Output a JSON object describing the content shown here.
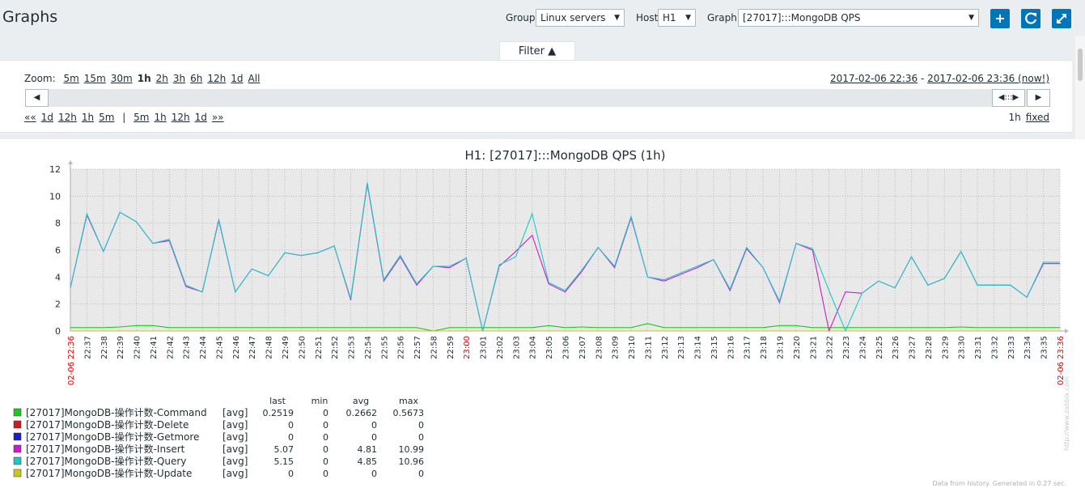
{
  "header": {
    "title": "Graphs",
    "group_label": "Group",
    "group_value": "Linux servers",
    "host_label": "Host",
    "host_value": "H1",
    "graph_label": "Graph",
    "graph_value": "[27017]:::MongoDB QPS"
  },
  "filter": {
    "tab_label": "Filter ▲",
    "zoom_label": "Zoom:",
    "zoom_options": [
      "5m",
      "15m",
      "30m",
      "1h",
      "2h",
      "3h",
      "6h",
      "12h",
      "1d",
      "All"
    ],
    "zoom_active": "1h",
    "period_from": "2017-02-06 22:36",
    "period_sep": " - ",
    "period_to": "2017-02-06 23:36 (now!)",
    "nav_back": [
      "««",
      "1d",
      "12h",
      "1h",
      "5m"
    ],
    "nav_sep": "|",
    "nav_fwd": [
      "5m",
      "1h",
      "12h",
      "1d",
      "»»"
    ],
    "period_len": "1h",
    "fixed_label": "fixed"
  },
  "colors": {
    "accent": "#0275b8",
    "command": "#1ec81e",
    "delete": "#c81e1e",
    "getmore": "#1e1ec8",
    "insert": "#c81ec8",
    "query": "#1ec8c8",
    "update": "#c8c81e",
    "red_label": "#dd0000"
  },
  "chart_data": {
    "type": "line",
    "title": "H1: [27017]:::MongoDB QPS (1h)",
    "ylim": [
      0,
      12
    ],
    "y_ticks": [
      "0",
      "2",
      "4",
      "6",
      "8",
      "10",
      "12"
    ],
    "x_start_label": "02-06 22:36",
    "x_end_label": "02-06 23:36",
    "x_mid_label": "23:00",
    "x_ticks": [
      "22:37",
      "22:38",
      "22:39",
      "22:40",
      "22:41",
      "22:42",
      "22:43",
      "22:44",
      "22:45",
      "22:46",
      "22:47",
      "22:48",
      "22:49",
      "22:50",
      "22:51",
      "22:52",
      "22:53",
      "22:54",
      "22:55",
      "22:56",
      "22:57",
      "22:58",
      "22:59",
      "23:00",
      "23:01",
      "23:02",
      "23:03",
      "23:04",
      "23:05",
      "23:06",
      "23:07",
      "23:08",
      "23:09",
      "23:10",
      "23:11",
      "23:12",
      "23:13",
      "23:14",
      "23:15",
      "23:16",
      "23:17",
      "23:18",
      "23:19",
      "23:20",
      "23:21",
      "23:22",
      "23:23",
      "23:24",
      "23:25",
      "23:26",
      "23:27",
      "23:28",
      "23:29",
      "23:30",
      "23:31",
      "23:32",
      "23:33",
      "23:34",
      "23:35"
    ],
    "grid": true,
    "series": [
      {
        "name": "[27017]MongoDB-操作计数-Command",
        "color": "#1ec81e",
        "values": [
          0.25,
          0.25,
          0.25,
          0.3,
          0.4,
          0.4,
          0.25,
          0.25,
          0.25,
          0.25,
          0.25,
          0.25,
          0.25,
          0.25,
          0.25,
          0.25,
          0.25,
          0.25,
          0.25,
          0.25,
          0.25,
          0.25,
          0.0,
          0.25,
          0.25,
          0.25,
          0.25,
          0.25,
          0.25,
          0.4,
          0.25,
          0.3,
          0.25,
          0.25,
          0.25,
          0.55,
          0.25,
          0.25,
          0.25,
          0.25,
          0.25,
          0.25,
          0.25,
          0.4,
          0.4,
          0.25,
          0.25,
          0.25,
          0.25,
          0.25,
          0.25,
          0.25,
          0.25,
          0.25,
          0.3,
          0.25,
          0.25,
          0.25,
          0.25,
          0.25,
          0.25
        ]
      },
      {
        "name": "[27017]MongoDB-操作计数-Insert",
        "color": "#c81ec8",
        "values": [
          3.2,
          8.6,
          5.9,
          8.8,
          8.1,
          6.5,
          6.7,
          3.3,
          2.9,
          8.2,
          2.9,
          4.6,
          4.1,
          5.8,
          5.6,
          5.8,
          6.3,
          2.3,
          10.9,
          3.7,
          5.5,
          3.4,
          4.8,
          4.7,
          5.4,
          0.0,
          4.8,
          5.9,
          7.1,
          3.5,
          2.9,
          4.4,
          6.2,
          4.7,
          8.4,
          4.0,
          3.7,
          4.2,
          4.7,
          5.3,
          3.0,
          6.1,
          4.7,
          2.1,
          6.5,
          6.0,
          0.0,
          2.9,
          2.8,
          3.7,
          3.2,
          5.5,
          3.4,
          3.9,
          5.9,
          3.4,
          3.4,
          3.4,
          2.5,
          5.0,
          5.0
        ]
      },
      {
        "name": "[27017]MongoDB-操作计数-Query",
        "color": "#1ec8c8",
        "values": [
          3.2,
          8.7,
          5.9,
          8.8,
          8.1,
          6.5,
          6.8,
          3.4,
          2.9,
          8.3,
          2.9,
          4.6,
          4.1,
          5.8,
          5.6,
          5.8,
          6.3,
          2.4,
          11.0,
          3.8,
          5.6,
          3.5,
          4.8,
          4.8,
          5.4,
          0.0,
          4.9,
          5.5,
          8.7,
          3.6,
          3.0,
          4.5,
          6.2,
          4.8,
          8.5,
          4.0,
          3.8,
          4.3,
          4.8,
          5.3,
          3.1,
          6.2,
          4.7,
          2.2,
          6.5,
          6.1,
          3.0,
          0.0,
          2.8,
          3.7,
          3.2,
          5.5,
          3.4,
          3.9,
          5.9,
          3.4,
          3.4,
          3.4,
          2.5,
          5.1,
          5.1
        ]
      },
      {
        "name": "[27017]MongoDB-操作计数-Getmore",
        "color": "#1e1ec8",
        "values": [
          0,
          0,
          0,
          0,
          0,
          0,
          0,
          0,
          0,
          0,
          0,
          0,
          0,
          0,
          0,
          0,
          0,
          0,
          0,
          0,
          0,
          0,
          0,
          0,
          0,
          0,
          0,
          0,
          0,
          0,
          0,
          0,
          0,
          0,
          0,
          0,
          0,
          0,
          0,
          0,
          0,
          0,
          0,
          0,
          0,
          0,
          0,
          0,
          0,
          0,
          0,
          0,
          0,
          0,
          0,
          0,
          0,
          0,
          0,
          0,
          0
        ]
      },
      {
        "name": "[27017]MongoDB-操作计数-Update",
        "color": "#c8c81e",
        "values": [
          0,
          0,
          0,
          0,
          0,
          0,
          0,
          0,
          0,
          0,
          0,
          0,
          0,
          0,
          0,
          0,
          0,
          0,
          0,
          0,
          0,
          0,
          0,
          0,
          0,
          0,
          0,
          0,
          0,
          0,
          0,
          0,
          0,
          0,
          0,
          0,
          0,
          0,
          0,
          0,
          0,
          0,
          0,
          0,
          0,
          0,
          0,
          0,
          0,
          0,
          0,
          0,
          0,
          0,
          0,
          0,
          0,
          0,
          0,
          0,
          0
        ]
      }
    ],
    "legend_headers": [
      "last",
      "min",
      "avg",
      "max"
    ],
    "legend": [
      {
        "name": "[27017]MongoDB-操作计数-Command",
        "color": "#1ec81e",
        "func": "[avg]",
        "last": "0.2519",
        "min": "0",
        "avg": "0.2662",
        "max": "0.5673"
      },
      {
        "name": "[27017]MongoDB-操作计数-Delete",
        "color": "#c81e1e",
        "func": "[avg]",
        "last": "0",
        "min": "0",
        "avg": "0",
        "max": "0"
      },
      {
        "name": "[27017]MongoDB-操作计数-Getmore",
        "color": "#1e1ec8",
        "func": "[avg]",
        "last": "0",
        "min": "0",
        "avg": "0",
        "max": "0"
      },
      {
        "name": "[27017]MongoDB-操作计数-Insert",
        "color": "#c81ec8",
        "func": "[avg]",
        "last": "5.07",
        "min": "0",
        "avg": "4.81",
        "max": "10.99"
      },
      {
        "name": "[27017]MongoDB-操作计数-Query",
        "color": "#1ec8c8",
        "func": "[avg]",
        "last": "5.15",
        "min": "0",
        "avg": "4.85",
        "max": "10.96"
      },
      {
        "name": "[27017]MongoDB-操作计数-Update",
        "color": "#c8c81e",
        "func": "[avg]",
        "last": "0",
        "min": "0",
        "avg": "0",
        "max": "0"
      }
    ],
    "footer": "Data from history. Generated in 0.27 sec.",
    "watermark": "http://www.zabbix.com"
  }
}
